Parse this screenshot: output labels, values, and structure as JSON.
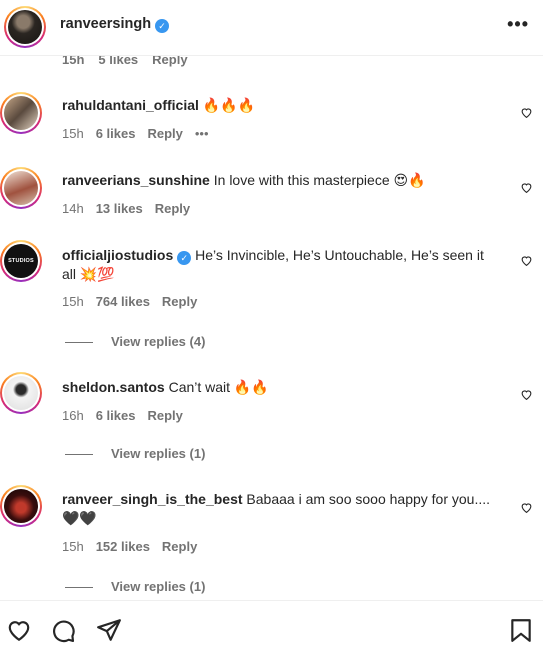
{
  "header": {
    "username": "ranveersingh",
    "verified": true,
    "more": "•••"
  },
  "cut_row": {
    "time": "15h",
    "likes": "5 likes",
    "reply": "Reply"
  },
  "comments": [
    {
      "username": "rahuldantani_official",
      "verified": false,
      "text": "🔥🔥🔥",
      "time": "15h",
      "likes": "6 likes",
      "reply": "Reply",
      "more": "•••",
      "view_replies": ""
    },
    {
      "username": "ranveerians_sunshine",
      "verified": false,
      "text": "In love with this masterpiece 😍🔥",
      "time": "14h",
      "likes": "13 likes",
      "reply": "Reply",
      "view_replies": ""
    },
    {
      "username": "officialjiostudios",
      "verified": true,
      "text": "He’s Invincible, He’s Untouchable, He’s seen it all 💥💯",
      "time": "15h",
      "likes": "764 likes",
      "reply": "Reply",
      "view_replies": "View replies (4)"
    },
    {
      "username": "sheldon.santos",
      "verified": false,
      "text": "Can’t wait 🔥🔥",
      "time": "16h",
      "likes": "6 likes",
      "reply": "Reply",
      "view_replies": "View replies (1)"
    },
    {
      "username": "ranveer_singh_is_the_best",
      "verified": false,
      "text": "Babaaa i am soo sooo happy for you.... 🖤🖤",
      "time": "15h",
      "likes": "152 likes",
      "reply": "Reply",
      "view_replies": "View replies (1)"
    }
  ],
  "jio_logo_text": "STUDIOS",
  "icons": {
    "like": "heart-icon",
    "comment": "comment-icon",
    "share": "share-icon",
    "save": "bookmark-icon"
  },
  "colors": {
    "verified": "#3897f0",
    "text": "#262626",
    "secondary": "#737373"
  }
}
